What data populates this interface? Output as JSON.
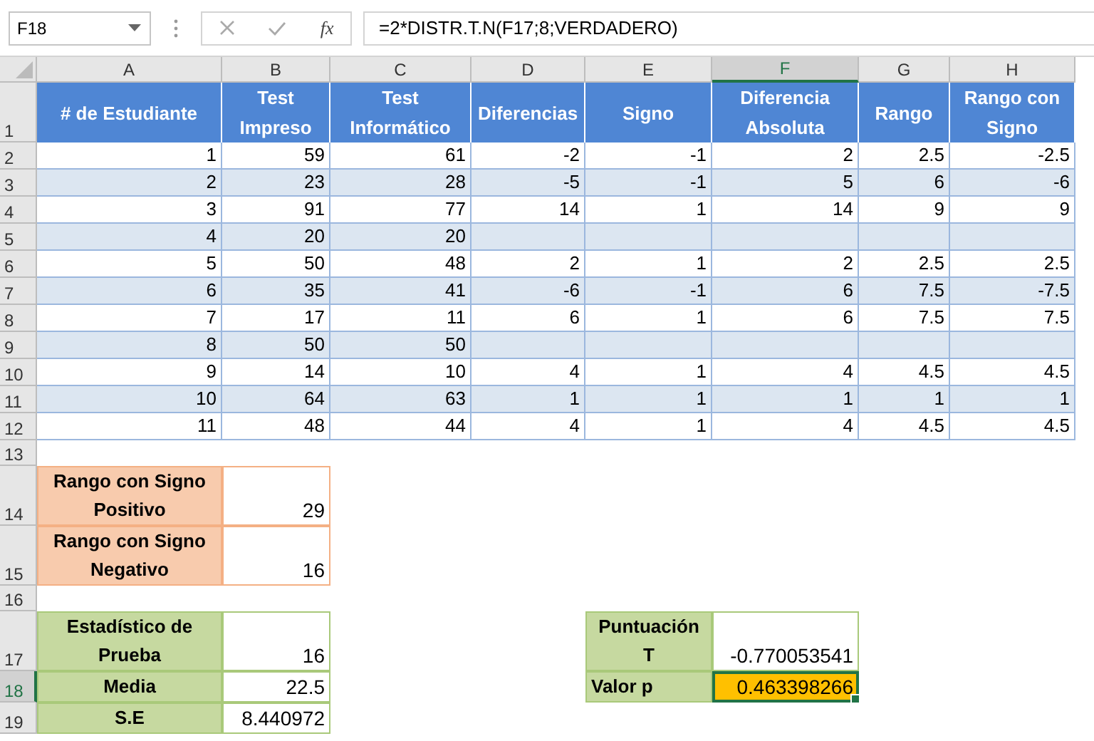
{
  "formula_bar": {
    "name_box": "F18",
    "function_label": "fx",
    "formula": "=2*DISTR.T.N(F17;8;VERDADERO)"
  },
  "columns": [
    {
      "label": "A",
      "selected": false
    },
    {
      "label": "B",
      "selected": false
    },
    {
      "label": "C",
      "selected": false
    },
    {
      "label": "D",
      "selected": false
    },
    {
      "label": "E",
      "selected": false
    },
    {
      "label": "F",
      "selected": true
    },
    {
      "label": "G",
      "selected": false
    },
    {
      "label": "H",
      "selected": false
    }
  ],
  "rows": [
    {
      "number": "1",
      "selected": false,
      "cells": [
        {
          "kind": "header",
          "text": "# de Estudiante"
        },
        {
          "kind": "header",
          "text": "Test Impreso"
        },
        {
          "kind": "header",
          "text": "Test Informático"
        },
        {
          "kind": "header",
          "text": "Diferencias"
        },
        {
          "kind": "header",
          "text": "Signo"
        },
        {
          "kind": "header",
          "text": "Diferencia Absoluta"
        },
        {
          "kind": "header",
          "text": "Rango"
        },
        {
          "kind": "header",
          "text": "Rango con Signo"
        }
      ]
    },
    {
      "number": "2",
      "selected": false,
      "cells": [
        {
          "kind": "plain",
          "text": "1"
        },
        {
          "kind": "plain",
          "text": "59"
        },
        {
          "kind": "plain",
          "text": "61"
        },
        {
          "kind": "plain",
          "text": "-2"
        },
        {
          "kind": "plain",
          "text": "-1"
        },
        {
          "kind": "plain",
          "text": "2"
        },
        {
          "kind": "plain",
          "text": "2.5"
        },
        {
          "kind": "plain",
          "text": "-2.5"
        }
      ]
    },
    {
      "number": "3",
      "selected": false,
      "cells": [
        {
          "kind": "banded",
          "text": "2"
        },
        {
          "kind": "banded",
          "text": "23"
        },
        {
          "kind": "banded",
          "text": "28"
        },
        {
          "kind": "banded",
          "text": "-5"
        },
        {
          "kind": "banded",
          "text": "-1"
        },
        {
          "kind": "banded",
          "text": "5"
        },
        {
          "kind": "banded",
          "text": "6"
        },
        {
          "kind": "banded",
          "text": "-6"
        }
      ]
    },
    {
      "number": "4",
      "selected": false,
      "cells": [
        {
          "kind": "plain",
          "text": "3"
        },
        {
          "kind": "plain",
          "text": "91"
        },
        {
          "kind": "plain",
          "text": "77"
        },
        {
          "kind": "plain",
          "text": "14"
        },
        {
          "kind": "plain",
          "text": "1"
        },
        {
          "kind": "plain",
          "text": "14"
        },
        {
          "kind": "plain",
          "text": "9"
        },
        {
          "kind": "plain",
          "text": "9"
        }
      ]
    },
    {
      "number": "5",
      "selected": false,
      "cells": [
        {
          "kind": "banded",
          "text": "4"
        },
        {
          "kind": "banded",
          "text": "20"
        },
        {
          "kind": "banded",
          "text": "20"
        },
        {
          "kind": "banded"
        },
        {
          "kind": "banded"
        },
        {
          "kind": "banded"
        },
        {
          "kind": "banded"
        },
        {
          "kind": "banded"
        }
      ]
    },
    {
      "number": "6",
      "selected": false,
      "cells": [
        {
          "kind": "plain",
          "text": "5"
        },
        {
          "kind": "plain",
          "text": "50"
        },
        {
          "kind": "plain",
          "text": "48"
        },
        {
          "kind": "plain",
          "text": "2"
        },
        {
          "kind": "plain",
          "text": "1"
        },
        {
          "kind": "plain",
          "text": "2"
        },
        {
          "kind": "plain",
          "text": "2.5"
        },
        {
          "kind": "plain",
          "text": "2.5"
        }
      ]
    },
    {
      "number": "7",
      "selected": false,
      "cells": [
        {
          "kind": "banded",
          "text": "6"
        },
        {
          "kind": "banded",
          "text": "35"
        },
        {
          "kind": "banded",
          "text": "41"
        },
        {
          "kind": "banded",
          "text": "-6"
        },
        {
          "kind": "banded",
          "text": "-1"
        },
        {
          "kind": "banded",
          "text": "6"
        },
        {
          "kind": "banded",
          "text": "7.5"
        },
        {
          "kind": "banded",
          "text": "-7.5"
        }
      ]
    },
    {
      "number": "8",
      "selected": false,
      "cells": [
        {
          "kind": "plain",
          "text": "7"
        },
        {
          "kind": "plain",
          "text": "17"
        },
        {
          "kind": "plain",
          "text": "11"
        },
        {
          "kind": "plain",
          "text": "6"
        },
        {
          "kind": "plain",
          "text": "1"
        },
        {
          "kind": "plain",
          "text": "6"
        },
        {
          "kind": "plain",
          "text": "7.5"
        },
        {
          "kind": "plain",
          "text": "7.5"
        }
      ]
    },
    {
      "number": "9",
      "selected": false,
      "cells": [
        {
          "kind": "banded",
          "text": "8"
        },
        {
          "kind": "banded",
          "text": "50"
        },
        {
          "kind": "banded",
          "text": "50"
        },
        {
          "kind": "banded"
        },
        {
          "kind": "banded"
        },
        {
          "kind": "banded"
        },
        {
          "kind": "banded"
        },
        {
          "kind": "banded"
        }
      ]
    },
    {
      "number": "10",
      "selected": false,
      "cells": [
        {
          "kind": "plain",
          "text": "9"
        },
        {
          "kind": "plain",
          "text": "14"
        },
        {
          "kind": "plain",
          "text": "10"
        },
        {
          "kind": "plain",
          "text": "4"
        },
        {
          "kind": "plain",
          "text": "1"
        },
        {
          "kind": "plain",
          "text": "4"
        },
        {
          "kind": "plain",
          "text": "4.5"
        },
        {
          "kind": "plain",
          "text": "4.5"
        }
      ]
    },
    {
      "number": "11",
      "selected": false,
      "cells": [
        {
          "kind": "banded",
          "text": "10"
        },
        {
          "kind": "banded",
          "text": "64"
        },
        {
          "kind": "banded",
          "text": "63"
        },
        {
          "kind": "banded",
          "text": "1"
        },
        {
          "kind": "banded",
          "text": "1"
        },
        {
          "kind": "banded",
          "text": "1"
        },
        {
          "kind": "banded",
          "text": "1"
        },
        {
          "kind": "banded",
          "text": "1"
        }
      ]
    },
    {
      "number": "12",
      "selected": false,
      "cells": [
        {
          "kind": "plain",
          "text": "11"
        },
        {
          "kind": "plain",
          "text": "48"
        },
        {
          "kind": "plain",
          "text": "44"
        },
        {
          "kind": "plain",
          "text": "4"
        },
        {
          "kind": "plain",
          "text": "1"
        },
        {
          "kind": "plain",
          "text": "4"
        },
        {
          "kind": "plain",
          "text": "4.5"
        },
        {
          "kind": "plain",
          "text": "4.5"
        }
      ]
    },
    {
      "number": "13",
      "selected": false
    },
    {
      "number": "14",
      "selected": false,
      "cells": [
        {
          "kind": "ranklabel",
          "text": "Rango con Signo Positivo"
        },
        {
          "kind": "rankvalue",
          "text": "29"
        }
      ]
    },
    {
      "number": "15",
      "selected": false,
      "cells": [
        {
          "kind": "ranklabel",
          "text": "Rango con Signo Negativo"
        },
        {
          "kind": "rankvalue",
          "text": "16"
        }
      ]
    },
    {
      "number": "16",
      "selected": false
    },
    {
      "number": "17",
      "selected": false,
      "cells": [
        {
          "kind": "statlabel",
          "text": "Estadístico de Prueba"
        },
        {
          "kind": "statvalue",
          "text": "16"
        },
        {
          "kind": "blank"
        },
        {
          "kind": "blank"
        },
        {
          "kind": "statlabel",
          "text": "Puntuación T"
        },
        {
          "kind": "statvalue",
          "text": "-0.770053541"
        }
      ]
    },
    {
      "number": "18",
      "selected": true,
      "cells": [
        {
          "kind": "statlabel",
          "text": "Media"
        },
        {
          "kind": "statvalue",
          "text": "22.5"
        },
        {
          "kind": "blank"
        },
        {
          "kind": "blank"
        },
        {
          "kind": "statlabelleft",
          "text": "Valor p"
        },
        {
          "kind": "highlight",
          "text": "0.463398266"
        }
      ]
    },
    {
      "number": "19",
      "selected": false,
      "cells": [
        {
          "kind": "statlabel",
          "text": "S.E"
        },
        {
          "kind": "statvalue",
          "text": "8.440972"
        }
      ]
    }
  ]
}
